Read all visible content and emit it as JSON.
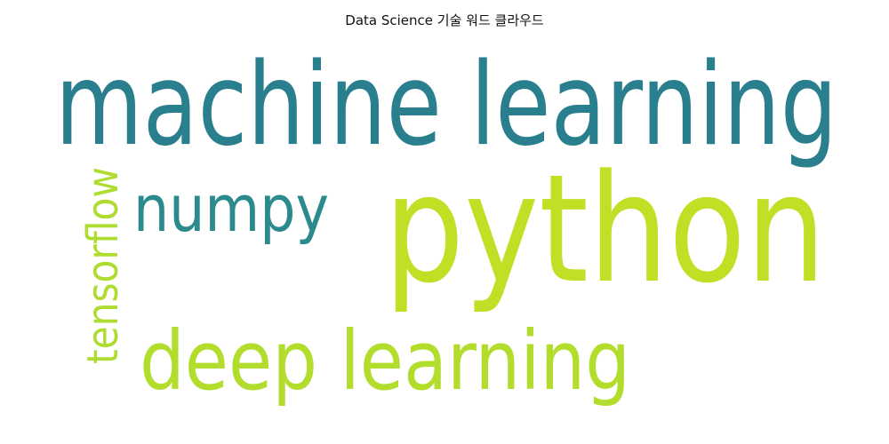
{
  "chart_data": {
    "type": "wordcloud",
    "title": "Data Science 기술 워드 클라우드",
    "words": [
      {
        "text": "machine learning",
        "weight": 100,
        "color": "#2a7f8e",
        "orientation": "horizontal"
      },
      {
        "text": "python",
        "weight": 100,
        "color": "#c0df25",
        "orientation": "horizontal"
      },
      {
        "text": "numpy",
        "weight": 55,
        "color": "#2a8a8c",
        "orientation": "horizontal"
      },
      {
        "text": "deep learning",
        "weight": 75,
        "color": "#b2dd2c",
        "orientation": "horizontal"
      },
      {
        "text": "tensorflow",
        "weight": 45,
        "color": "#aedc30",
        "orientation": "vertical"
      }
    ]
  }
}
